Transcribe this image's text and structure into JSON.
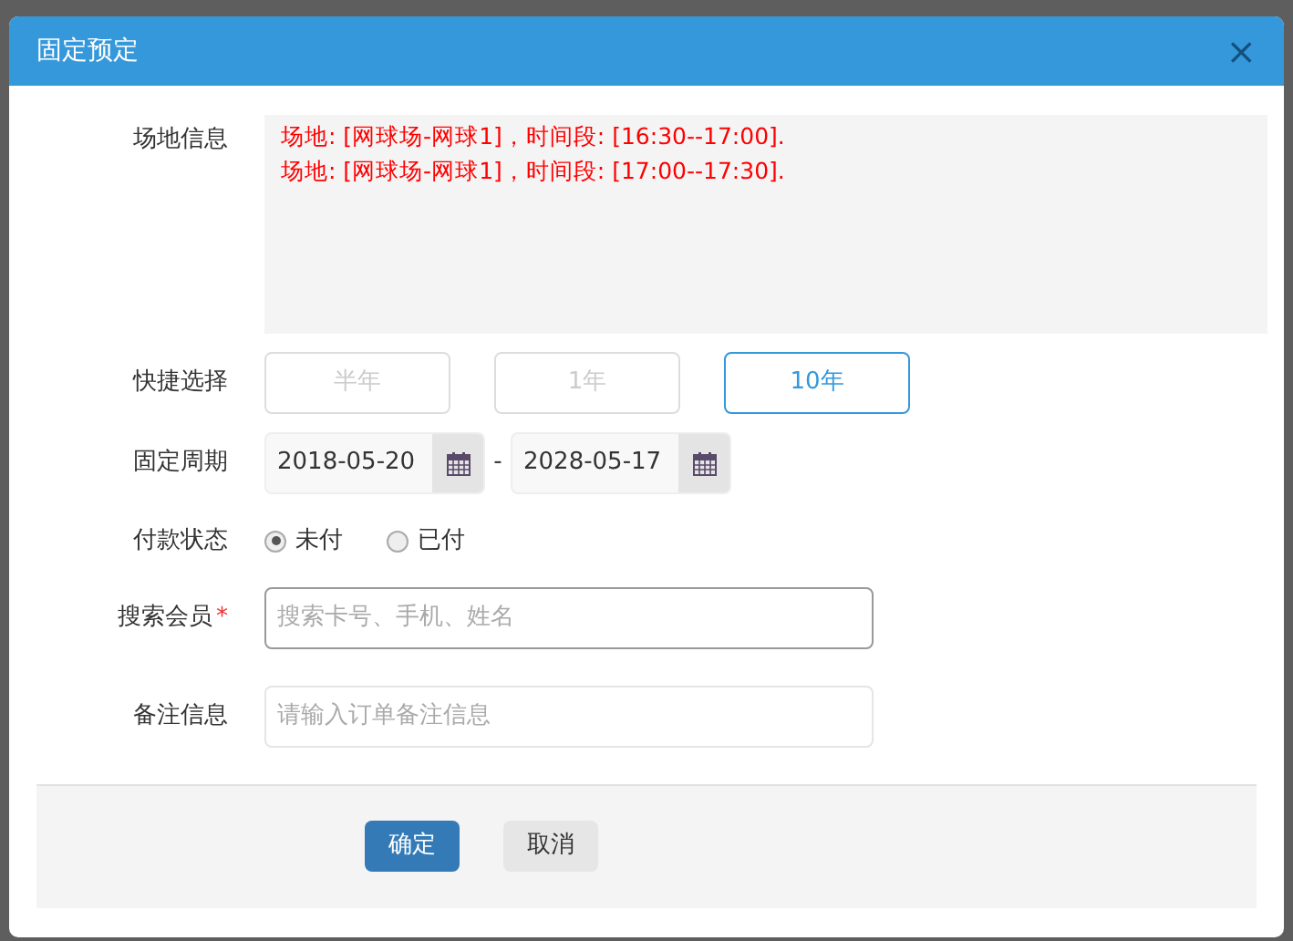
{
  "dialog": {
    "title": "固定预定",
    "close": "×"
  },
  "venue_info": {
    "label": "场地信息",
    "lines": [
      "场地: [网球场-网球1]，时间段: [16:30--17:00].",
      "场地: [网球场-网球1]，时间段: [17:00--17:30]."
    ]
  },
  "quick_select": {
    "label": "快捷选择",
    "options": [
      {
        "label": "半年",
        "selected": false
      },
      {
        "label": "1年",
        "selected": false
      },
      {
        "label": "10年",
        "selected": true
      }
    ]
  },
  "period": {
    "label": "固定周期",
    "start": "2018-05-20",
    "separator": "-",
    "end": "2028-05-17"
  },
  "payment": {
    "label": "付款状态",
    "options": [
      {
        "label": "未付",
        "selected": true
      },
      {
        "label": "已付",
        "selected": false
      }
    ]
  },
  "member": {
    "label": "搜索会员",
    "required_mark": "*",
    "placeholder": "搜索卡号、手机、姓名"
  },
  "notes": {
    "label": "备注信息",
    "placeholder": "请输入订单备注信息"
  },
  "buttons": [
    {
      "kind": "primary",
      "label": "确定"
    },
    {
      "kind": "default",
      "label": "取消"
    }
  ]
}
